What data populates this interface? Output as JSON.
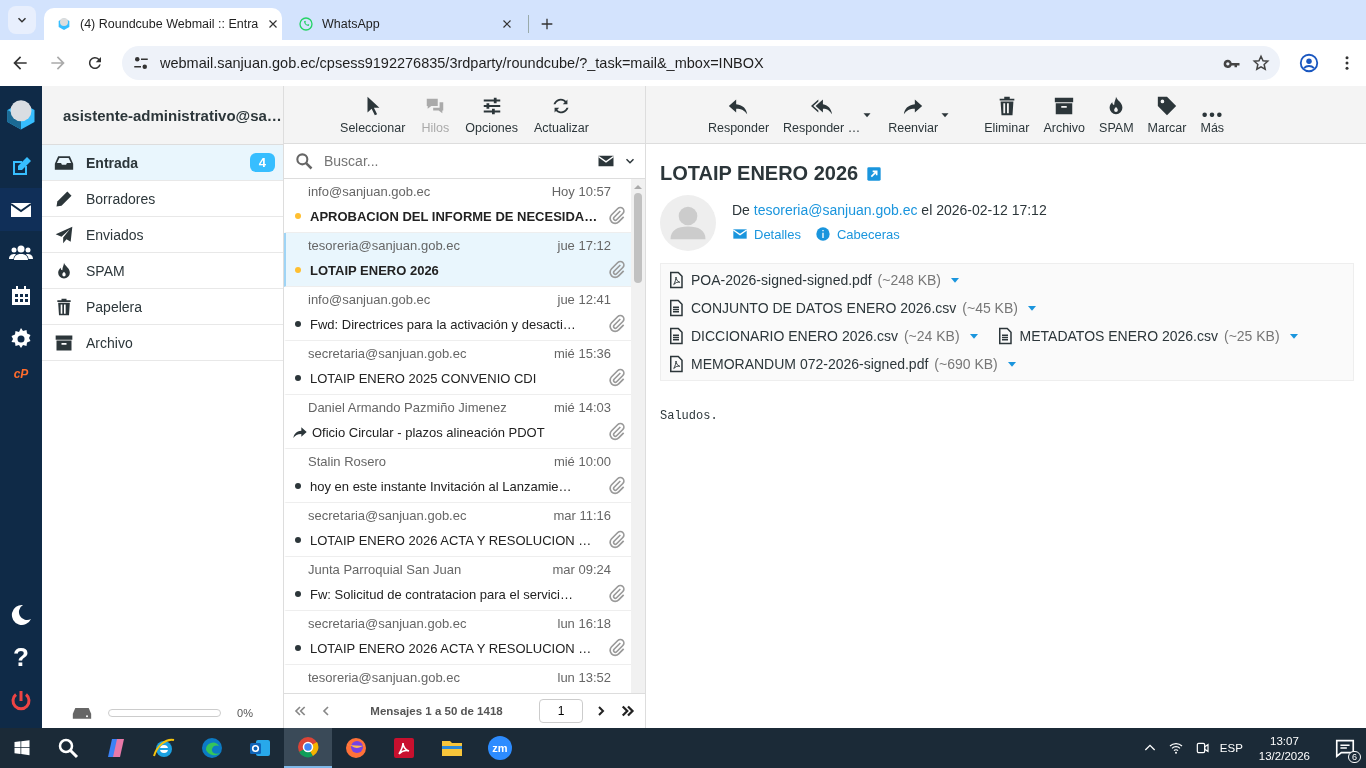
{
  "browser": {
    "tabs": [
      {
        "title": "(4) Roundcube Webmail :: Entra",
        "kind": "roundcube",
        "selected": true
      },
      {
        "title": "WhatsApp",
        "kind": "whatsapp",
        "selected": false
      }
    ],
    "url": "webmail.sanjuan.gob.ec/cpsess9192276835/3rdparty/roundcube/?_task=mail&_mbox=INBOX"
  },
  "rail": {
    "items": [
      {
        "kind": "compose",
        "selected": false
      },
      {
        "kind": "mail",
        "selected": true
      },
      {
        "kind": "contacts",
        "selected": false
      },
      {
        "kind": "calendar",
        "selected": false
      },
      {
        "kind": "settings",
        "selected": false
      },
      {
        "kind": "cpanel",
        "label": "cP",
        "selected": false
      }
    ],
    "bottom": [
      {
        "kind": "theme"
      },
      {
        "kind": "help",
        "label": "?"
      },
      {
        "kind": "logout"
      }
    ]
  },
  "folders": {
    "account": "asistente-administrativo@sa…",
    "items": [
      {
        "name": "Entrada",
        "kind": "inbox",
        "selected": true,
        "unread": "4"
      },
      {
        "name": "Borradores",
        "kind": "drafts",
        "selected": false
      },
      {
        "name": "Enviados",
        "kind": "sent",
        "selected": false
      },
      {
        "name": "SPAM",
        "kind": "spam",
        "selected": false
      },
      {
        "name": "Papelera",
        "kind": "trash",
        "selected": false
      },
      {
        "name": "Archivo",
        "kind": "archive",
        "selected": false
      }
    ],
    "quota": {
      "reading": "0%",
      "level": 0
    }
  },
  "list": {
    "toolbar": [
      {
        "label": "Seleccionar",
        "kind": "select",
        "disabled": false
      },
      {
        "label": "Hilos",
        "kind": "threads",
        "disabled": true
      },
      {
        "label": "Opciones",
        "kind": "options",
        "disabled": false
      },
      {
        "label": "Actualizar",
        "kind": "refresh",
        "disabled": false
      }
    ],
    "search": {
      "placeholder": "Buscar..."
    },
    "messages": [
      {
        "from": "info@sanjuan.gob.ec",
        "date": "Hoy 10:57",
        "subject": "APROBACION DEL INFORME DE NECESIDA…",
        "unread": true,
        "forwarded": false,
        "selected": false,
        "attachment": true
      },
      {
        "from": "tesoreria@sanjuan.gob.ec",
        "date": "jue 17:12",
        "subject": "LOTAIP ENERO 2026",
        "unread": true,
        "forwarded": false,
        "selected": true,
        "attachment": true
      },
      {
        "from": "info@sanjuan.gob.ec",
        "date": "jue 12:41",
        "subject": "Fwd: Directrices para la activación y desacti…",
        "unread": false,
        "forwarded": false,
        "selected": false,
        "attachment": true
      },
      {
        "from": "secretaria@sanjuan.gob.ec",
        "date": "mié 15:36",
        "subject": "LOTAIP ENERO 2025 CONVENIO CDI",
        "unread": false,
        "forwarded": false,
        "selected": false,
        "attachment": true
      },
      {
        "from": "Daniel Armando Pazmiño Jimenez",
        "date": "mié 14:03",
        "subject": "Oficio Circular - plazos alineación PDOT",
        "unread": false,
        "forwarded": true,
        "selected": false,
        "attachment": true
      },
      {
        "from": "Stalin Rosero",
        "date": "mié 10:00",
        "subject": "hoy en este instante Invitación al Lanzamie…",
        "unread": false,
        "forwarded": false,
        "selected": false,
        "attachment": true
      },
      {
        "from": "secretaria@sanjuan.gob.ec",
        "date": "mar 11:16",
        "subject": "LOTAIP ENERO 2026 ACTA Y RESOLUCION …",
        "unread": false,
        "forwarded": false,
        "selected": false,
        "attachment": true
      },
      {
        "from": "Junta Parroquial San Juan",
        "date": "mar 09:24",
        "subject": "Fw: Solicitud de contratacion para el servici…",
        "unread": false,
        "forwarded": false,
        "selected": false,
        "attachment": true
      },
      {
        "from": "secretaria@sanjuan.gob.ec",
        "date": "lun 16:18",
        "subject": "LOTAIP ENERO 2026 ACTA Y RESOLUCION …",
        "unread": false,
        "forwarded": false,
        "selected": false,
        "attachment": true
      },
      {
        "from": "tesoreria@sanjuan.gob.ec",
        "date": "lun 13:52",
        "selected": false,
        "attachment": false
      }
    ],
    "pagination": {
      "summary": "Mensajes 1 a 50 de 1418",
      "page": "1"
    }
  },
  "message": {
    "toolbar": [
      {
        "label": "Responder",
        "kind": "reply",
        "dropdown": false
      },
      {
        "label": "Responder …",
        "kind": "reply-all",
        "dropdown": true
      },
      {
        "label": "Reenviar",
        "kind": "forward",
        "dropdown": true
      },
      {
        "label": "Eliminar",
        "kind": "trash",
        "dropdown": false
      },
      {
        "label": "Archivo",
        "kind": "archive",
        "dropdown": false
      },
      {
        "label": "SPAM",
        "kind": "spam",
        "dropdown": false
      },
      {
        "label": "Marcar",
        "kind": "tag",
        "dropdown": false
      },
      {
        "label": "Más",
        "kind": "more",
        "dropdown": false
      }
    ],
    "subject": "LOTAIP ENERO 2026",
    "from_prefix": "De",
    "from": "tesoreria@sanjuan.gob.ec",
    "date": "el 2026-02-12 17:12",
    "links": [
      {
        "label": "Detalles",
        "kind": "envelope"
      },
      {
        "label": "Cabeceras",
        "kind": "info"
      }
    ],
    "attachments": [
      {
        "name": "POA-2026-signed-signed.pdf",
        "size": "(~248 KB)",
        "kind": "pdf"
      },
      {
        "name": "CONJUNTO DE DATOS ENERO 2026.csv",
        "size": "(~45 KB)",
        "kind": "text"
      },
      {
        "name": "DICCIONARIO ENERO 2026.csv",
        "size": "(~24 KB)",
        "kind": "text"
      },
      {
        "name": "METADATOS ENERO 2026.csv",
        "size": "(~25 KB)",
        "kind": "text"
      },
      {
        "name": "MEMORANDUM 072-2026-signed.pdf",
        "size": "(~690 KB)",
        "kind": "pdf"
      }
    ],
    "body": "Saludos."
  },
  "taskbar": {
    "apps": [
      {
        "kind": "copilot",
        "active": false
      },
      {
        "kind": "ie",
        "active": false
      },
      {
        "kind": "edge",
        "active": false
      },
      {
        "kind": "outlook",
        "active": false
      },
      {
        "kind": "chrome",
        "active": true
      },
      {
        "kind": "firefox",
        "active": false
      },
      {
        "kind": "acrobat",
        "active": false
      },
      {
        "kind": "explorer",
        "active": false
      },
      {
        "kind": "zoom",
        "label": "zm",
        "active": false
      }
    ],
    "language": "ESP",
    "time": "13:07",
    "date": "13/2/2026",
    "notifications": "6"
  }
}
